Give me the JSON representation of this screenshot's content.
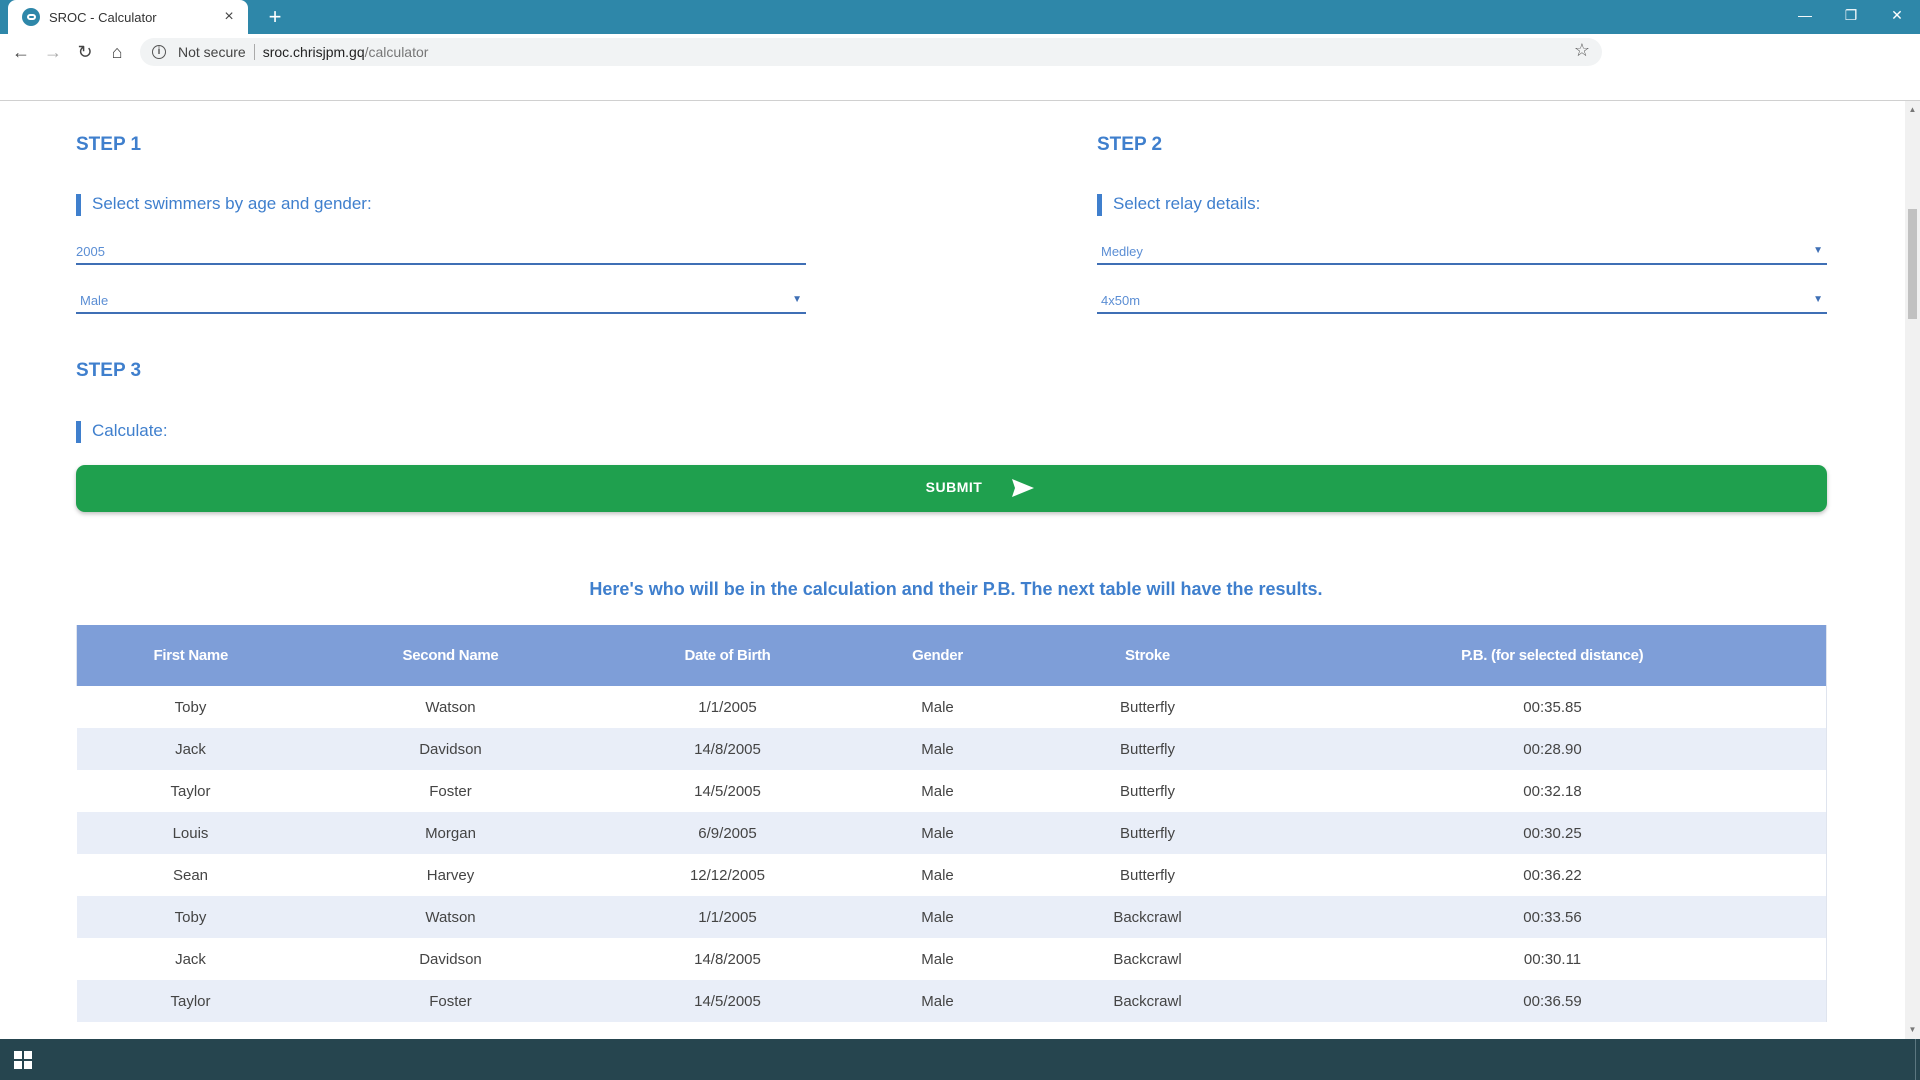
{
  "browser": {
    "tab_title": "SROC - Calculator",
    "tab_close": "×",
    "new_tab": "+",
    "security_label": "Not secure",
    "url_host": "sroc.chrisjpm.gq",
    "url_path": "/calculator"
  },
  "step1": {
    "title": "STEP 1",
    "label": "Select swimmers by age and gender:",
    "year_value": "2005",
    "gender_value": "Male"
  },
  "step2": {
    "title": "STEP 2",
    "label": "Select relay details:",
    "stroke_value": "Medley",
    "distance_value": "4x50m"
  },
  "step3": {
    "title": "STEP 3",
    "label": "Calculate:",
    "submit_label": "SUBMIT"
  },
  "intro_text": "Here's who will be in the calculation and their P.B. The next table will have the results.",
  "table": {
    "headers": [
      "First Name",
      "Second Name",
      "Date of Birth",
      "Gender",
      "Stroke",
      "P.B. (for selected distance)"
    ],
    "rows": [
      [
        "Toby",
        "Watson",
        "1/1/2005",
        "Male",
        "Butterfly",
        "00:35.85"
      ],
      [
        "Jack",
        "Davidson",
        "14/8/2005",
        "Male",
        "Butterfly",
        "00:28.90"
      ],
      [
        "Taylor",
        "Foster",
        "14/5/2005",
        "Male",
        "Butterfly",
        "00:32.18"
      ],
      [
        "Louis",
        "Morgan",
        "6/9/2005",
        "Male",
        "Butterfly",
        "00:30.25"
      ],
      [
        "Sean",
        "Harvey",
        "12/12/2005",
        "Male",
        "Butterfly",
        "00:36.22"
      ],
      [
        "Toby",
        "Watson",
        "1/1/2005",
        "Male",
        "Backcrawl",
        "00:33.56"
      ],
      [
        "Jack",
        "Davidson",
        "14/8/2005",
        "Male",
        "Backcrawl",
        "00:30.11"
      ],
      [
        "Taylor",
        "Foster",
        "14/5/2005",
        "Male",
        "Backcrawl",
        "00:36.59"
      ]
    ]
  },
  "colors": {
    "tab_bar": "#2e87a9",
    "accent_blue": "#3f7fcd",
    "submit_green": "#1fa04e",
    "table_header": "#7e9ed8",
    "row_alt": "#e9eef8",
    "taskbar": "#26454f"
  }
}
